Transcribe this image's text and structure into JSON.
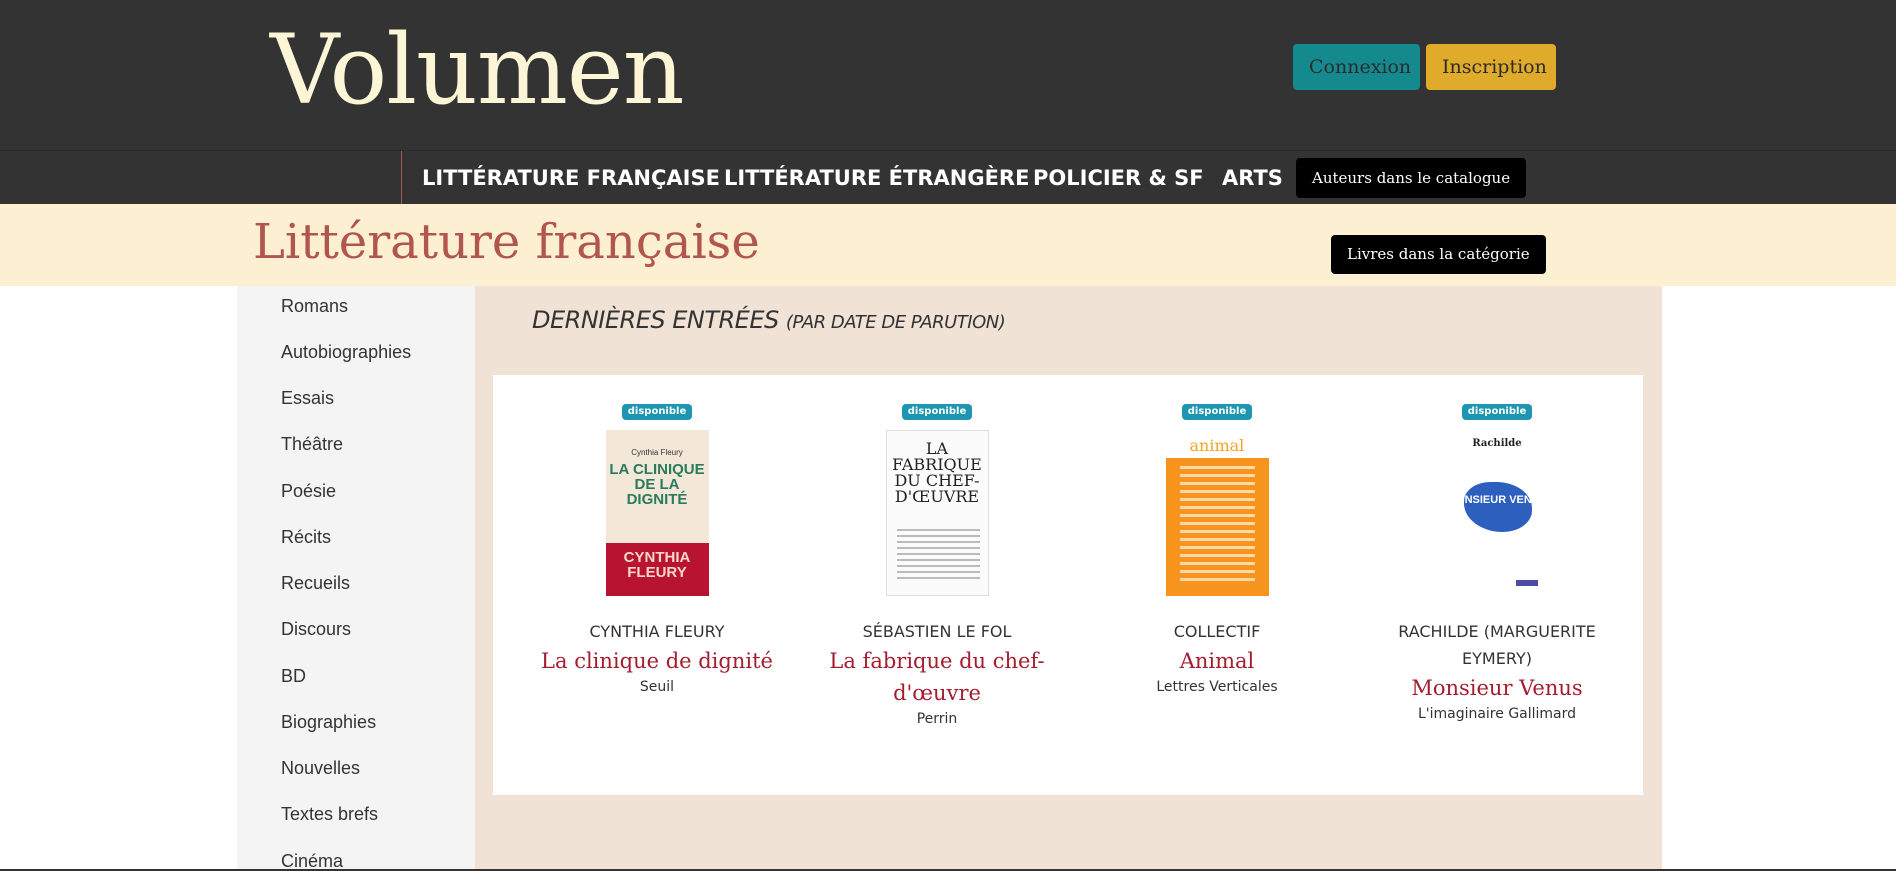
{
  "header": {
    "logo": "Volumen",
    "login_label": "Connexion",
    "signup_label": "Inscription"
  },
  "nav": {
    "items": [
      "LITTÉRATURE FRANÇAISE",
      "LITTÉRATURE ÉTRANGÈRE",
      "POLICIER & SF",
      "ARTS"
    ],
    "authors_button": "Auteurs dans le catalogue"
  },
  "category": {
    "title": "Littérature française",
    "books_button": "Livres dans la catégorie"
  },
  "sidebar": {
    "items": [
      "Romans",
      "Autobiographies",
      "Essais",
      "Théâtre",
      "Poésie",
      "Récits",
      "Recueils",
      "Discours",
      "BD",
      "Biographies",
      "Nouvelles",
      "Textes brefs",
      "Cinéma"
    ]
  },
  "main": {
    "section_title": "DERNIÈRES ENTRÉES",
    "section_subtitle": "(PAR DATE DE PARUTION)",
    "books": [
      {
        "badge": "disponible",
        "author": "CYNTHIA FLEURY",
        "title": "La clinique de dignité",
        "publisher": "Seuil",
        "cover": {
          "author": "Cynthia Fleury",
          "title": "LA CLINIQUE DE LA DIGNITÉ",
          "name": "CYNTHIA FLEURY"
        }
      },
      {
        "badge": "disponible",
        "author": "SÉBASTIEN LE FOL",
        "title": "La fabrique du chef-d'œuvre",
        "publisher": "Perrin",
        "cover": {
          "title": "LA FABRIQUE DU CHEF-D'ŒUVRE"
        }
      },
      {
        "badge": "disponible",
        "author": "COLLECTIF",
        "title": "Animal",
        "publisher": "Lettres Verticales",
        "cover": {
          "word": "animal"
        }
      },
      {
        "badge": "disponible",
        "author": "RACHILDE (MARGUERITE EYMERY)",
        "title": "Monsieur Venus",
        "publisher": "L'imaginaire Gallimard",
        "cover": {
          "author": "Rachilde",
          "title": "MONSIEUR VENUS"
        }
      }
    ]
  }
}
